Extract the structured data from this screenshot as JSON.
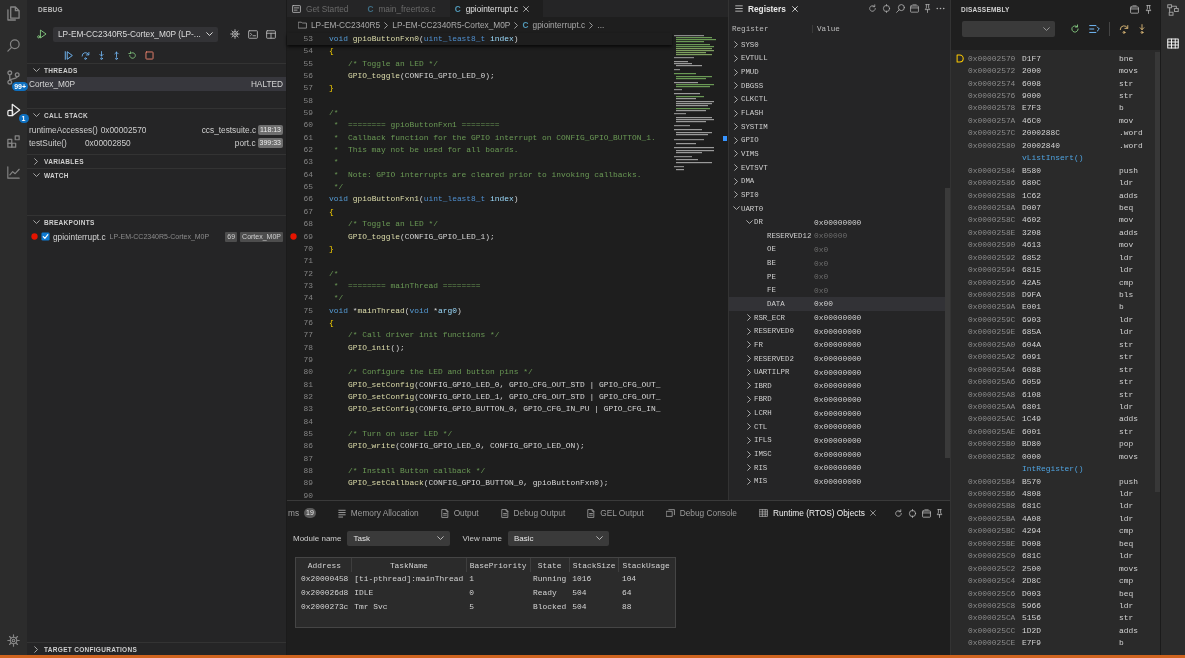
{
  "activity_bar": {
    "items": [
      {
        "selected": false
      },
      {
        "selected": false
      },
      {
        "selected": false,
        "badge": "99+"
      },
      {
        "selected": true,
        "badge": "1"
      },
      {
        "selected": false
      },
      {
        "selected": false
      }
    ]
  },
  "debug_view": {
    "title": "DEBUG",
    "launch_config": "LP-EM-CC2340R5-Cortex_M0P (LP-...",
    "threads": {
      "title": "THREADS",
      "expanded": true,
      "items": [
        {
          "name": "Cortex_M0P",
          "status": "HALTED",
          "selected": true
        }
      ]
    },
    "call_stack": {
      "title": "CALL STACK",
      "expanded": true,
      "frames": [
        {
          "function": "runtimeAccesses()",
          "address": "0x00002570",
          "file": "ccs_testsuite.c",
          "position": "118:13"
        },
        {
          "function": "testSuite()",
          "address": "0x00002850",
          "file": "port.c",
          "position": "399:33"
        }
      ]
    },
    "variables": {
      "title": "VARIABLES",
      "expanded": false
    },
    "watch": {
      "title": "WATCH",
      "expanded": true
    },
    "breakpoints": {
      "title": "BREAKPOINTS",
      "expanded": true,
      "items": [
        {
          "file": "gpiointerrupt.c",
          "path": "LP-EM-CC2340R5-Cortex_M0P",
          "line": "69",
          "core": "Cortex_M0P",
          "checked": true
        }
      ]
    },
    "target_configurations": {
      "title": "TARGET CONFIGURATIONS",
      "expanded": false
    }
  },
  "editor": {
    "tabs": [
      {
        "label": "Get Started",
        "selected": false
      },
      {
        "label": "main_freertos.c",
        "file_icon": "C",
        "selected": false
      },
      {
        "label": "gpiointerrupt.c",
        "file_icon": "C",
        "selected": true
      }
    ],
    "breadcrumb": [
      {
        "kind": "project",
        "label": "LP-EM-CC2340R5"
      },
      {
        "kind": "folder",
        "label": "LP-EM-CC2340R5-Cortex_M0P"
      },
      {
        "kind": "file",
        "file_icon": "C",
        "label": "gpiointerrupt.c"
      },
      {
        "kind": "more",
        "label": "..."
      }
    ],
    "lines": [
      {
        "number": "53",
        "breakpoint": false,
        "tokens": [
          {
            "text": "void ",
            "kind": "keyword"
          },
          {
            "text": "gpioButtonFxn0",
            "kind": "function"
          },
          {
            "text": "(",
            "kind": "plain"
          },
          {
            "text": "uint_least8_t ",
            "kind": "type"
          },
          {
            "text": "index",
            "kind": "param"
          },
          {
            "text": ")",
            "kind": "plain"
          }
        ]
      },
      {
        "number": "54",
        "breakpoint": false,
        "tokens": [
          {
            "text": "{",
            "kind": "bracket"
          }
        ]
      },
      {
        "number": "55",
        "breakpoint": false,
        "tokens": [
          {
            "text": "    /* Toggle an LED */",
            "kind": "comment"
          }
        ]
      },
      {
        "number": "56",
        "breakpoint": false,
        "tokens": [
          {
            "text": "    GPIO_toggle",
            "kind": "function"
          },
          {
            "text": "(",
            "kind": "plain"
          },
          {
            "text": "CONFIG_GPIO_LED_0",
            "kind": "macro"
          },
          {
            "text": ");",
            "kind": "plain"
          }
        ]
      },
      {
        "number": "57",
        "breakpoint": false,
        "tokens": [
          {
            "text": "}",
            "kind": "bracket"
          }
        ]
      },
      {
        "number": "58",
        "breakpoint": false
      },
      {
        "number": "59",
        "breakpoint": false,
        "tokens": [
          {
            "text": "/*",
            "kind": "comment"
          }
        ]
      },
      {
        "number": "60",
        "breakpoint": false,
        "tokens": [
          {
            "text": " *  ======== gpioButtonFxn1 ========",
            "kind": "comment"
          }
        ]
      },
      {
        "number": "61",
        "breakpoint": false,
        "tokens": [
          {
            "text": " *  Callback function for the GPIO interrupt on CONFIG_GPIO_BUTTON_1.",
            "kind": "comment"
          }
        ]
      },
      {
        "number": "62",
        "breakpoint": false,
        "tokens": [
          {
            "text": " *  This may not be used for all boards.",
            "kind": "comment"
          }
        ]
      },
      {
        "number": "63",
        "breakpoint": false,
        "tokens": [
          {
            "text": " *",
            "kind": "comment"
          }
        ]
      },
      {
        "number": "64",
        "breakpoint": false,
        "tokens": [
          {
            "text": " *  Note: GPIO interrupts are cleared prior to invoking callbacks.",
            "kind": "comment"
          }
        ]
      },
      {
        "number": "65",
        "breakpoint": false,
        "tokens": [
          {
            "text": " */",
            "kind": "comment"
          }
        ]
      },
      {
        "number": "66",
        "breakpoint": false,
        "tokens": [
          {
            "text": "void ",
            "kind": "keyword"
          },
          {
            "text": "gpioButtonFxn1",
            "kind": "function"
          },
          {
            "text": "(",
            "kind": "plain"
          },
          {
            "text": "uint_least8_t ",
            "kind": "type"
          },
          {
            "text": "index",
            "kind": "param"
          },
          {
            "text": ")",
            "kind": "plain"
          }
        ]
      },
      {
        "number": "67",
        "breakpoint": false,
        "tokens": [
          {
            "text": "{",
            "kind": "bracket"
          }
        ]
      },
      {
        "number": "68",
        "breakpoint": false,
        "tokens": [
          {
            "text": "    /* Toggle an LED */",
            "kind": "comment"
          }
        ]
      },
      {
        "number": "69",
        "breakpoint": true,
        "tokens": [
          {
            "text": "    GPIO_toggle",
            "kind": "function"
          },
          {
            "text": "(",
            "kind": "plain"
          },
          {
            "text": "CONFIG_GPIO_LED_1",
            "kind": "macro"
          },
          {
            "text": ");",
            "kind": "plain"
          }
        ]
      },
      {
        "number": "70",
        "breakpoint": false,
        "tokens": [
          {
            "text": "}",
            "kind": "bracket"
          }
        ]
      },
      {
        "number": "71",
        "breakpoint": false
      },
      {
        "number": "72",
        "breakpoint": false,
        "tokens": [
          {
            "text": "/*",
            "kind": "comment"
          }
        ]
      },
      {
        "number": "73",
        "breakpoint": false,
        "tokens": [
          {
            "text": " *  ======== mainThread ========",
            "kind": "comment"
          }
        ]
      },
      {
        "number": "74",
        "breakpoint": false,
        "tokens": [
          {
            "text": " */",
            "kind": "comment"
          }
        ]
      },
      {
        "number": "75",
        "breakpoint": false,
        "tokens": [
          {
            "text": "void ",
            "kind": "keyword"
          },
          {
            "text": "*",
            "kind": "plain"
          },
          {
            "text": "mainThread",
            "kind": "function"
          },
          {
            "text": "(",
            "kind": "plain"
          },
          {
            "text": "void ",
            "kind": "keyword"
          },
          {
            "text": "*",
            "kind": "plain"
          },
          {
            "text": "arg0",
            "kind": "param"
          },
          {
            "text": ")",
            "kind": "plain"
          }
        ]
      },
      {
        "number": "76",
        "breakpoint": false,
        "tokens": [
          {
            "text": "{",
            "kind": "bracket"
          }
        ]
      },
      {
        "number": "77",
        "breakpoint": false,
        "tokens": [
          {
            "text": "    /* Call driver init functions */",
            "kind": "comment"
          }
        ]
      },
      {
        "number": "78",
        "breakpoint": false,
        "tokens": [
          {
            "text": "    GPIO_init",
            "kind": "function"
          },
          {
            "text": "();",
            "kind": "plain"
          }
        ]
      },
      {
        "number": "79",
        "breakpoint": false
      },
      {
        "number": "80",
        "breakpoint": false,
        "tokens": [
          {
            "text": "    /* Configure the LED and button pins */",
            "kind": "comment"
          }
        ]
      },
      {
        "number": "81",
        "breakpoint": false,
        "tokens": [
          {
            "text": "    GPIO_setConfig",
            "kind": "function"
          },
          {
            "text": "(",
            "kind": "plain"
          },
          {
            "text": "CONFIG_GPIO_LED_0, GPIO_CFG_OUT_STD | GPIO_CFG_OUT_",
            "kind": "macro"
          }
        ]
      },
      {
        "number": "82",
        "breakpoint": false,
        "tokens": [
          {
            "text": "    GPIO_setConfig",
            "kind": "function"
          },
          {
            "text": "(",
            "kind": "plain"
          },
          {
            "text": "CONFIG_GPIO_LED_1, GPIO_CFG_OUT_STD | GPIO_CFG_OUT_",
            "kind": "macro"
          }
        ]
      },
      {
        "number": "83",
        "breakpoint": false,
        "tokens": [
          {
            "text": "    GPIO_setConfig",
            "kind": "function"
          },
          {
            "text": "(",
            "kind": "plain"
          },
          {
            "text": "CONFIG_GPIO_BUTTON_0, GPIO_CFG_IN_PU | GPIO_CFG_IN_",
            "kind": "macro"
          }
        ]
      },
      {
        "number": "84",
        "breakpoint": false
      },
      {
        "number": "85",
        "breakpoint": false,
        "tokens": [
          {
            "text": "    /* Turn on user LED */",
            "kind": "comment"
          }
        ]
      },
      {
        "number": "86",
        "breakpoint": false,
        "tokens": [
          {
            "text": "    GPIO_write",
            "kind": "function"
          },
          {
            "text": "(",
            "kind": "plain"
          },
          {
            "text": "CONFIG_GPIO_LED_0, CONFIG_GPIO_LED_ON",
            "kind": "macro"
          },
          {
            "text": ");",
            "kind": "plain"
          }
        ]
      },
      {
        "number": "87",
        "breakpoint": false
      },
      {
        "number": "88",
        "breakpoint": false,
        "tokens": [
          {
            "text": "    /* Install Button callback */",
            "kind": "comment"
          }
        ]
      },
      {
        "number": "89",
        "breakpoint": false,
        "tokens": [
          {
            "text": "    GPIO_setCallback",
            "kind": "function"
          },
          {
            "text": "(",
            "kind": "plain"
          },
          {
            "text": "CONFIG_GPIO_BUTTON_0, gpioButtonFxn0",
            "kind": "macro"
          },
          {
            "text": ");",
            "kind": "plain"
          }
        ]
      },
      {
        "number": "90",
        "breakpoint": false
      }
    ]
  },
  "registers": {
    "tab": "Registers",
    "columns": [
      "Register",
      "Value"
    ],
    "rows": [
      {
        "name": "SYS0",
        "expanded": false,
        "selected": false
      },
      {
        "name": "EVTULL",
        "expanded": false,
        "selected": false
      },
      {
        "name": "PMUD",
        "expanded": false,
        "selected": false
      },
      {
        "name": "DBGSS",
        "expanded": false,
        "selected": false
      },
      {
        "name": "CLKCTL",
        "expanded": false,
        "selected": false
      },
      {
        "name": "FLASH",
        "expanded": false,
        "selected": false
      },
      {
        "name": "SYSTIM",
        "expanded": false,
        "selected": false
      },
      {
        "name": "GPIO",
        "expanded": false,
        "selected": false
      },
      {
        "name": "VIMS",
        "expanded": false,
        "selected": false
      },
      {
        "name": "EVTSVT",
        "expanded": false,
        "selected": false
      },
      {
        "name": "DMA",
        "expanded": false,
        "selected": false
      },
      {
        "name": "SPI0",
        "expanded": false,
        "selected": false
      },
      {
        "name": "UART0",
        "expanded": true,
        "selected": false,
        "children": [
          {
            "name": "DR",
            "value": "0x00000000",
            "expanded": true,
            "selected": false,
            "children": [
              {
                "name": "RESERVED12",
                "value": "0x00000",
                "selected": false
              },
              {
                "name": "OE",
                "value": "0x0",
                "selected": false
              },
              {
                "name": "BE",
                "value": "0x0",
                "selected": false
              },
              {
                "name": "PE",
                "value": "0x0",
                "selected": false
              },
              {
                "name": "FE",
                "value": "0x0",
                "selected": false
              },
              {
                "name": "DATA",
                "value": "0x00",
                "selected": true
              }
            ]
          },
          {
            "name": "RSR_ECR",
            "value": "0x00000000",
            "expanded": false,
            "selected": false
          },
          {
            "name": "RESERVED0",
            "value": "0x00000000",
            "expanded": false,
            "selected": false
          },
          {
            "name": "FR",
            "value": "0x00000000",
            "expanded": false,
            "selected": false
          },
          {
            "name": "RESERVED2",
            "value": "0x00000000",
            "expanded": false,
            "selected": false
          },
          {
            "name": "UARTILPR",
            "value": "0x00000000",
            "expanded": false,
            "selected": false
          },
          {
            "name": "IBRD",
            "value": "0x00000000",
            "expanded": false,
            "selected": false
          },
          {
            "name": "FBRD",
            "value": "0x00000000",
            "expanded": false,
            "selected": false
          },
          {
            "name": "LCRH",
            "value": "0x00000000",
            "expanded": false,
            "selected": false
          },
          {
            "name": "CTL",
            "value": "0x00000000",
            "expanded": false,
            "selected": false
          },
          {
            "name": "IFLS",
            "value": "0x00000000",
            "expanded": false,
            "selected": false
          },
          {
            "name": "IMSC",
            "value": "0x00000000",
            "expanded": false,
            "selected": false
          },
          {
            "name": "RIS",
            "value": "0x00000000",
            "expanded": false,
            "selected": false
          },
          {
            "name": "MIS",
            "value": "0x00000000",
            "expanded": false,
            "selected": false
          }
        ]
      }
    ]
  },
  "bottom_panel": {
    "tabs": [
      {
        "label": "ms",
        "badge": "19",
        "selected": false
      },
      {
        "label": "Memory Allocation",
        "selected": false
      },
      {
        "label": "Output",
        "selected": false
      },
      {
        "label": "Debug Output",
        "selected": false
      },
      {
        "label": "GEL Output",
        "selected": false
      },
      {
        "label": "Debug Console",
        "selected": false
      },
      {
        "label": "Runtime (RTOS) Objects",
        "selected": true
      }
    ],
    "module_name": {
      "label": "Module name",
      "value": "Task"
    },
    "view_name": {
      "label": "View name",
      "value": "Basic"
    },
    "table": {
      "columns": [
        "Address",
        "TaskName",
        "BasePriority",
        "State",
        "StackSize",
        "StackUsage"
      ],
      "rows": [
        [
          "0x20000458",
          "[ti-pthread]:mainThread",
          "1",
          "Running",
          "1016",
          "104"
        ],
        [
          "0x200026d8",
          "IDLE",
          "0",
          "Ready",
          "504",
          "64"
        ],
        [
          "0x2000273c",
          "Tmr Svc",
          "5",
          "Blocked",
          "504",
          "88"
        ]
      ]
    }
  },
  "disassembly": {
    "title": "DISASSEMBLY",
    "rows": [
      {
        "kind": "instruction",
        "address": "0x00002570",
        "opcode": "D1F7",
        "mnemonic": "bne",
        "current": true
      },
      {
        "kind": "instruction",
        "address": "0x00002572",
        "opcode": "2000",
        "mnemonic": "movs",
        "current": false
      },
      {
        "kind": "instruction",
        "address": "0x00002574",
        "opcode": "6008",
        "mnemonic": "str",
        "current": false
      },
      {
        "kind": "instruction",
        "address": "0x00002576",
        "opcode": "9000",
        "mnemonic": "str",
        "current": false
      },
      {
        "kind": "instruction",
        "address": "0x00002578",
        "opcode": "E7F3",
        "mnemonic": "b",
        "current": false
      },
      {
        "kind": "instruction",
        "address": "0x0000257A",
        "opcode": "46C0",
        "mnemonic": "mov",
        "current": false
      },
      {
        "kind": "instruction",
        "address": "0x0000257C",
        "opcode": "2000288C",
        "mnemonic": ".word",
        "current": false
      },
      {
        "kind": "instruction",
        "address": "0x00002580",
        "opcode": "20002840",
        "mnemonic": ".word",
        "current": false
      },
      {
        "kind": "label",
        "label": "vListInsert()",
        "current": false
      },
      {
        "kind": "instruction",
        "address": "0x00002584",
        "opcode": "B580",
        "mnemonic": "push",
        "current": false
      },
      {
        "kind": "instruction",
        "address": "0x00002586",
        "opcode": "680C",
        "mnemonic": "ldr",
        "current": false
      },
      {
        "kind": "instruction",
        "address": "0x00002588",
        "opcode": "1C62",
        "mnemonic": "adds",
        "current": false
      },
      {
        "kind": "instruction",
        "address": "0x0000258A",
        "opcode": "D007",
        "mnemonic": "beq",
        "current": false
      },
      {
        "kind": "instruction",
        "address": "0x0000258C",
        "opcode": "4602",
        "mnemonic": "mov",
        "current": false
      },
      {
        "kind": "instruction",
        "address": "0x0000258E",
        "opcode": "3208",
        "mnemonic": "adds",
        "current": false
      },
      {
        "kind": "instruction",
        "address": "0x00002590",
        "opcode": "4613",
        "mnemonic": "mov",
        "current": false
      },
      {
        "kind": "instruction",
        "address": "0x00002592",
        "opcode": "6852",
        "mnemonic": "ldr",
        "current": false
      },
      {
        "kind": "instruction",
        "address": "0x00002594",
        "opcode": "6815",
        "mnemonic": "ldr",
        "current": false
      },
      {
        "kind": "instruction",
        "address": "0x00002596",
        "opcode": "42A5",
        "mnemonic": "cmp",
        "current": false
      },
      {
        "kind": "instruction",
        "address": "0x00002598",
        "opcode": "D9FA",
        "mnemonic": "bls",
        "current": false
      },
      {
        "kind": "instruction",
        "address": "0x0000259A",
        "opcode": "E001",
        "mnemonic": "b",
        "current": false
      },
      {
        "kind": "instruction",
        "address": "0x0000259C",
        "opcode": "6903",
        "mnemonic": "ldr",
        "current": false
      },
      {
        "kind": "instruction",
        "address": "0x0000259E",
        "opcode": "685A",
        "mnemonic": "ldr",
        "current": false
      },
      {
        "kind": "instruction",
        "address": "0x000025A0",
        "opcode": "604A",
        "mnemonic": "str",
        "current": false
      },
      {
        "kind": "instruction",
        "address": "0x000025A2",
        "opcode": "6091",
        "mnemonic": "str",
        "current": false
      },
      {
        "kind": "instruction",
        "address": "0x000025A4",
        "opcode": "6088",
        "mnemonic": "str",
        "current": false
      },
      {
        "kind": "instruction",
        "address": "0x000025A6",
        "opcode": "6059",
        "mnemonic": "str",
        "current": false
      },
      {
        "kind": "instruction",
        "address": "0x000025A8",
        "opcode": "6108",
        "mnemonic": "str",
        "current": false
      },
      {
        "kind": "instruction",
        "address": "0x000025AA",
        "opcode": "6801",
        "mnemonic": "ldr",
        "current": false
      },
      {
        "kind": "instruction",
        "address": "0x000025AC",
        "opcode": "1C49",
        "mnemonic": "adds",
        "current": false
      },
      {
        "kind": "instruction",
        "address": "0x000025AE",
        "opcode": "6001",
        "mnemonic": "str",
        "current": false
      },
      {
        "kind": "instruction",
        "address": "0x000025B0",
        "opcode": "BD80",
        "mnemonic": "pop",
        "current": false
      },
      {
        "kind": "instruction",
        "address": "0x000025B2",
        "opcode": "0000",
        "mnemonic": "movs",
        "current": false
      },
      {
        "kind": "label",
        "label": "IntRegister()",
        "current": false
      },
      {
        "kind": "instruction",
        "address": "0x000025B4",
        "opcode": "B570",
        "mnemonic": "push",
        "current": false
      },
      {
        "kind": "instruction",
        "address": "0x000025B6",
        "opcode": "4808",
        "mnemonic": "ldr",
        "current": false
      },
      {
        "kind": "instruction",
        "address": "0x000025B8",
        "opcode": "681C",
        "mnemonic": "ldr",
        "current": false
      },
      {
        "kind": "instruction",
        "address": "0x000025BA",
        "opcode": "4A08",
        "mnemonic": "ldr",
        "current": false
      },
      {
        "kind": "instruction",
        "address": "0x000025BC",
        "opcode": "4294",
        "mnemonic": "cmp",
        "current": false
      },
      {
        "kind": "instruction",
        "address": "0x000025BE",
        "opcode": "D008",
        "mnemonic": "beq",
        "current": false
      },
      {
        "kind": "instruction",
        "address": "0x000025C0",
        "opcode": "681C",
        "mnemonic": "ldr",
        "current": false
      },
      {
        "kind": "instruction",
        "address": "0x000025C2",
        "opcode": "2500",
        "mnemonic": "movs",
        "current": false
      },
      {
        "kind": "instruction",
        "address": "0x000025C4",
        "opcode": "2D8C",
        "mnemonic": "cmp",
        "current": false
      },
      {
        "kind": "instruction",
        "address": "0x000025C6",
        "opcode": "D003",
        "mnemonic": "beq",
        "current": false
      },
      {
        "kind": "instruction",
        "address": "0x000025C8",
        "opcode": "5966",
        "mnemonic": "ldr",
        "current": false
      },
      {
        "kind": "instruction",
        "address": "0x000025CA",
        "opcode": "5156",
        "mnemonic": "str",
        "current": false
      },
      {
        "kind": "instruction",
        "address": "0x000025CC",
        "opcode": "1D2D",
        "mnemonic": "adds",
        "current": false
      },
      {
        "kind": "instruction",
        "address": "0x000025CE",
        "opcode": "E7F9",
        "mnemonic": "b",
        "current": false
      }
    ]
  }
}
